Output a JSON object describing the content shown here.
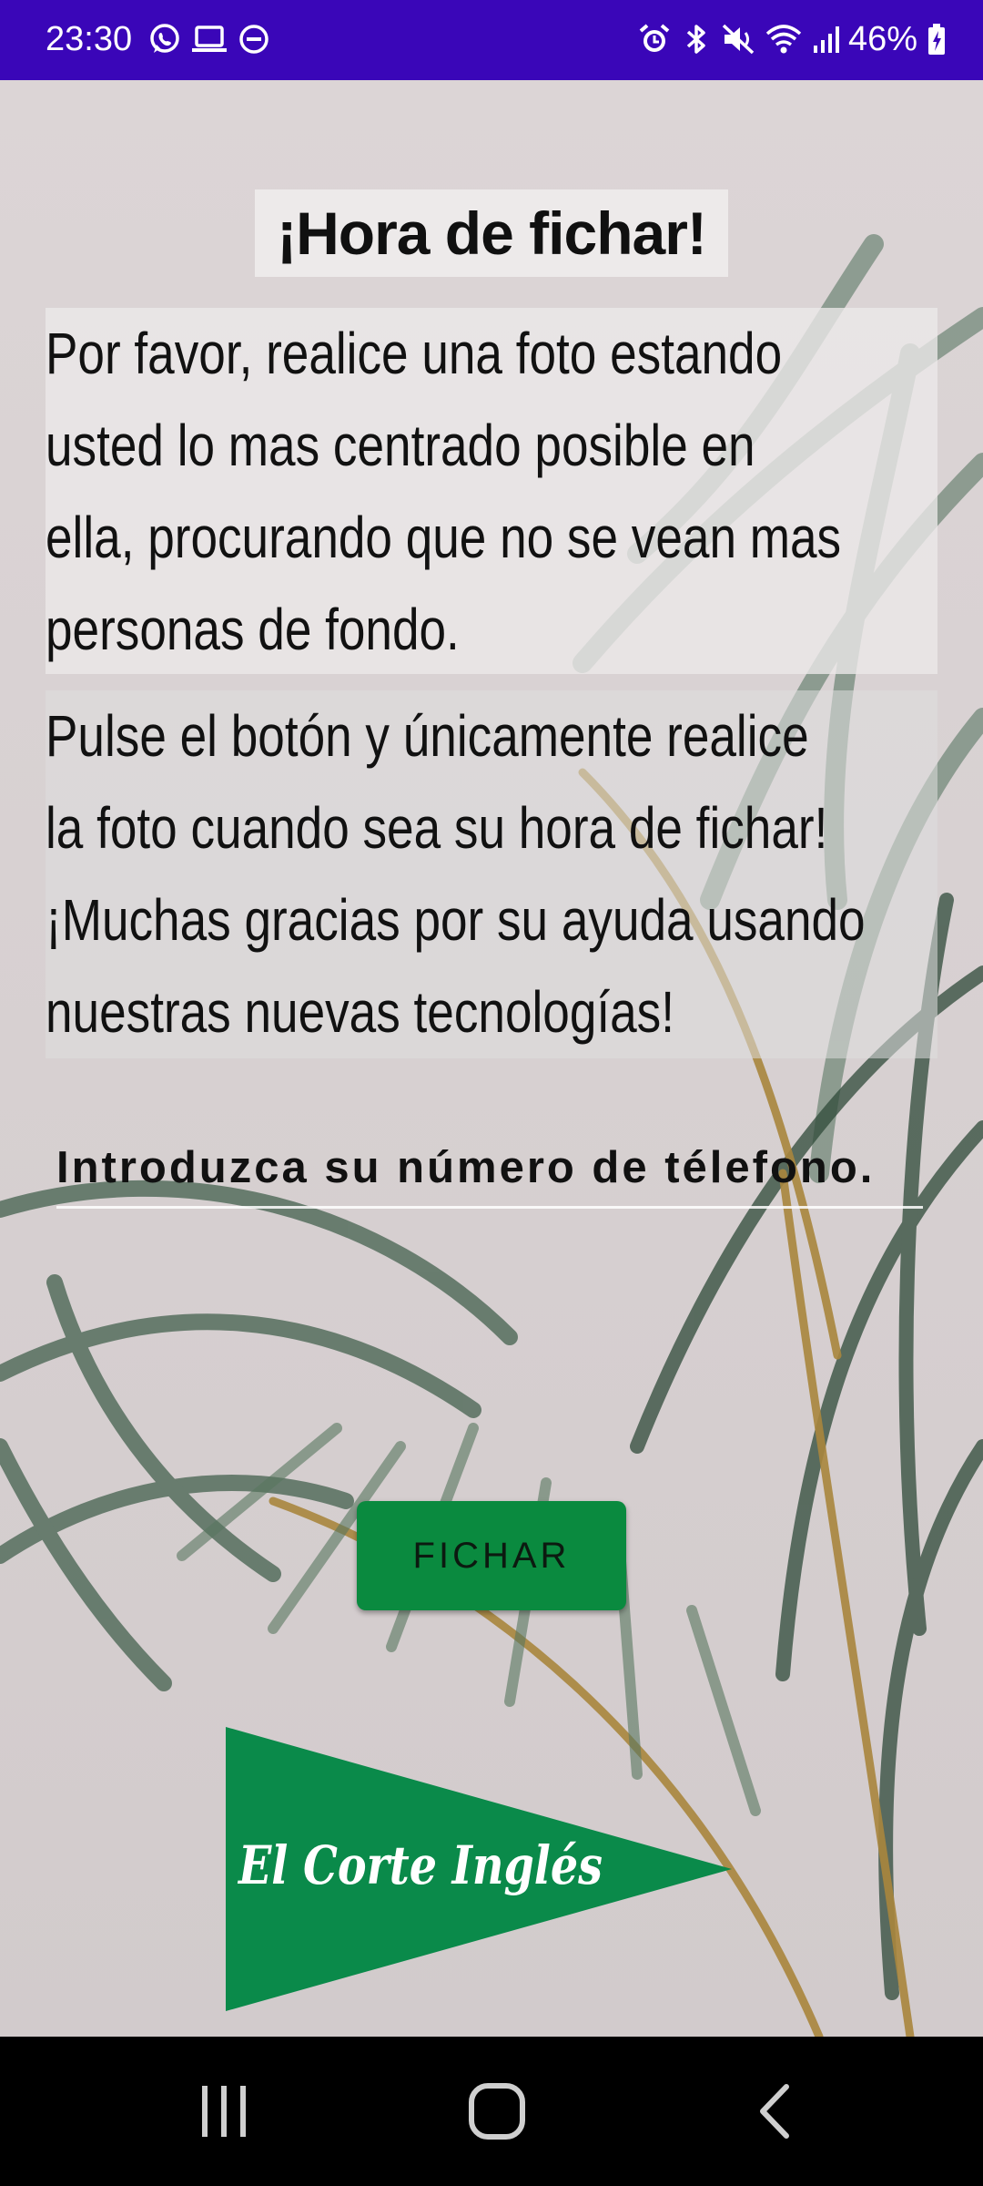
{
  "status_bar": {
    "time": "23:30",
    "battery_percent": "46%",
    "left_icons": [
      "whatsapp-icon",
      "laptop-icon",
      "do-not-disturb-icon"
    ],
    "right_icons": [
      "alarm-icon",
      "bluetooth-icon",
      "mute-icon",
      "wifi-icon",
      "signal-icon",
      "battery-charging-icon"
    ]
  },
  "main": {
    "title": "¡Hora de fichar!",
    "paragraph_1": "Por favor, realice una foto estando\nusted lo mas centrado posible en\nella, procurando que no se vean mas\npersonas de fondo.",
    "paragraph_2": "Pulse el botón y únicamente realice\nla foto cuando sea su hora de fichar!\n¡Muchas gracias por su ayuda usando\nnuestras nuevas tecnologías!",
    "phone_placeholder": "Introduzca su número de télefono.",
    "button_label": "FICHAR",
    "logo_text": "El Corte Inglés"
  },
  "nav_bar": {
    "items": [
      "recent-apps-icon",
      "home-icon",
      "back-icon"
    ]
  },
  "colors": {
    "status_bar": "#3a06b8",
    "button": "#0a8a3f",
    "logo_green": "#0a8a4a"
  }
}
